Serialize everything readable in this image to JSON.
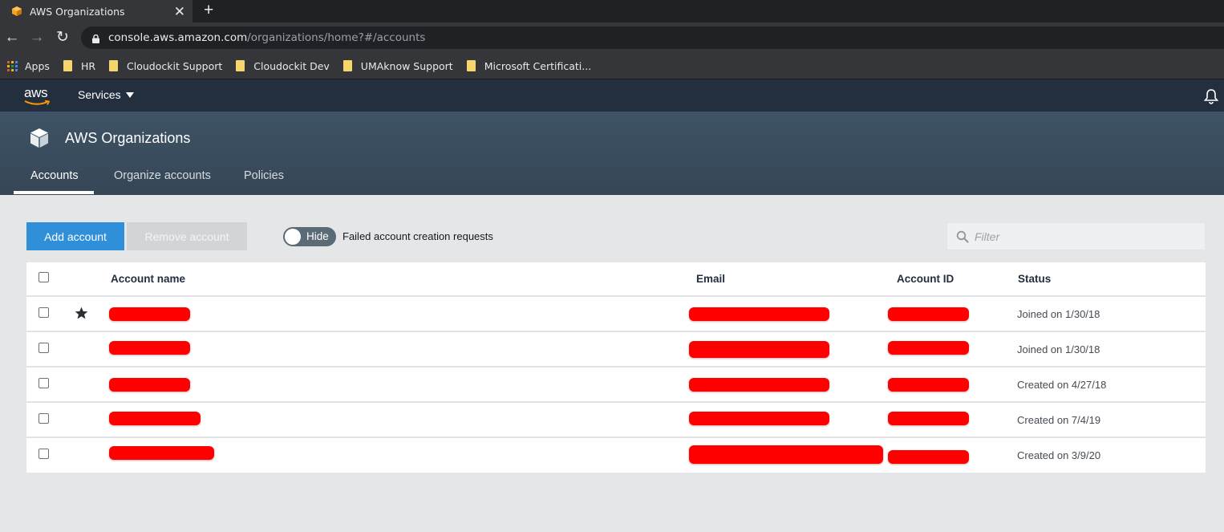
{
  "browser": {
    "tab_title": "AWS Organizations",
    "tab_close": "✕",
    "new_tab": "+",
    "back": "←",
    "forward": "→",
    "reload": "↻",
    "url_host": "console.aws.amazon.com",
    "url_path": "/organizations/home?#/accounts",
    "bookmarks": [
      "Apps",
      "HR",
      "Cloudockit Support",
      "Cloudockit Dev",
      "UMAknow Support",
      "Microsoft Certificati..."
    ]
  },
  "aws_header": {
    "logo_text": "aws",
    "services_label": "Services"
  },
  "service": {
    "title": "AWS Organizations",
    "tabs": [
      "Accounts",
      "Organize accounts",
      "Policies"
    ],
    "active_tab": "Accounts"
  },
  "actions": {
    "add_account": "Add account",
    "remove_account": "Remove account",
    "toggle_label": "Hide",
    "toggle_description": "Failed account creation requests",
    "filter_placeholder": "Filter"
  },
  "table": {
    "headers": {
      "account_name": "Account name",
      "email": "Email",
      "account_id": "Account ID",
      "status": "Status"
    },
    "rows": [
      {
        "status": "Joined on 1/30/18",
        "starred": true
      },
      {
        "status": "Joined on 1/30/18",
        "starred": false
      },
      {
        "status": "Created on 4/27/18",
        "starred": false
      },
      {
        "status": "Created on 7/4/19",
        "starred": false
      },
      {
        "status": "Created on 3/9/20",
        "starred": false
      }
    ]
  },
  "colors": {
    "aws_nav": "#232f3e",
    "service_header": "#3e5366",
    "primary_button": "#2f8fd9",
    "redaction": "#ff0000",
    "aws_orange": "#ff9900"
  }
}
